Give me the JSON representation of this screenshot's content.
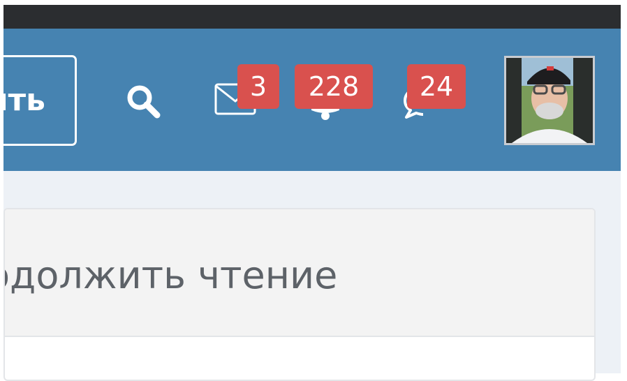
{
  "header": {
    "action_button_label": "ить",
    "badges": {
      "messages": "3",
      "notifications": "228",
      "chat": "24"
    }
  },
  "card": {
    "title": "одолжить чтение"
  },
  "colors": {
    "navbar": "#4683b1",
    "badge": "#d9514e",
    "top_strip": "#2b2d30",
    "content_bg": "#edf1f6",
    "card_header": "#f3f3f3",
    "card_title": "#5d6268"
  },
  "icons": [
    "search-icon",
    "envelope-icon",
    "bell-icon",
    "chat-icon"
  ]
}
